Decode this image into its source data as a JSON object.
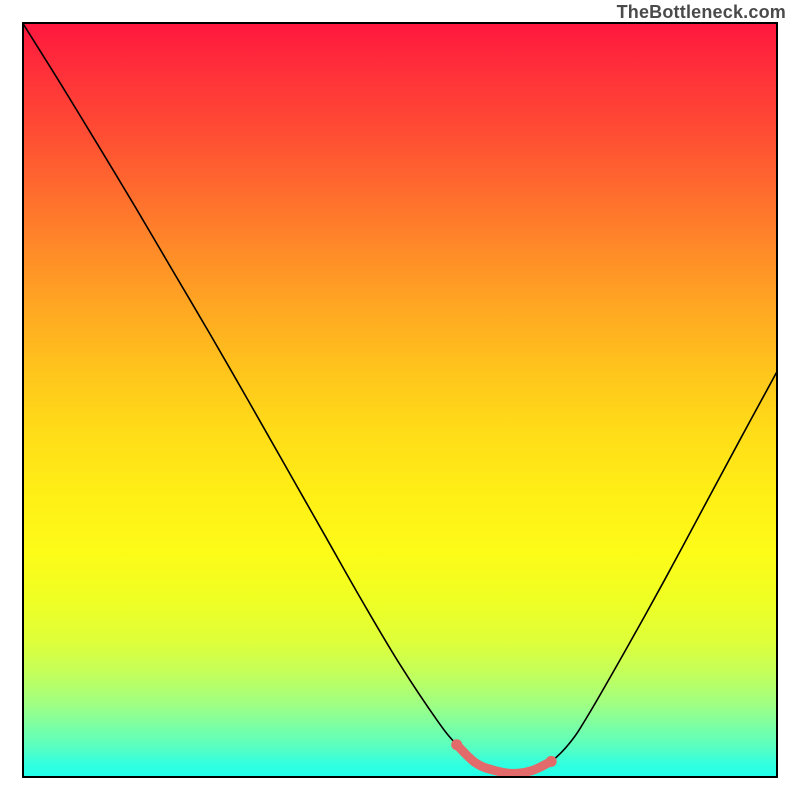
{
  "attribution": "TheBottleneck.com",
  "colors": {
    "curve": "#000000",
    "highlight": "#e36a6a",
    "gradient_top": "#ff173f",
    "gradient_bottom": "#20ffec",
    "border": "#000000"
  },
  "chart_data": {
    "type": "line",
    "title": "",
    "xlabel": "",
    "ylabel": "",
    "xlim": [
      0,
      1
    ],
    "ylim": [
      0,
      1
    ],
    "x": [
      0.0,
      0.05,
      0.1,
      0.15,
      0.2,
      0.25,
      0.3,
      0.35,
      0.4,
      0.45,
      0.5,
      0.55,
      0.575,
      0.6,
      0.625,
      0.65,
      0.675,
      0.7,
      0.725,
      0.75,
      0.8,
      0.85,
      0.9,
      0.95,
      1.0
    ],
    "values": [
      1.0,
      0.92,
      0.838,
      0.755,
      0.67,
      0.585,
      0.498,
      0.41,
      0.322,
      0.234,
      0.15,
      0.075,
      0.044,
      0.02,
      0.01,
      0.006,
      0.01,
      0.022,
      0.047,
      0.085,
      0.172,
      0.262,
      0.355,
      0.448,
      0.54
    ],
    "highlight_segment": {
      "x_start": 0.575,
      "x_end": 0.7
    },
    "annotations": []
  }
}
